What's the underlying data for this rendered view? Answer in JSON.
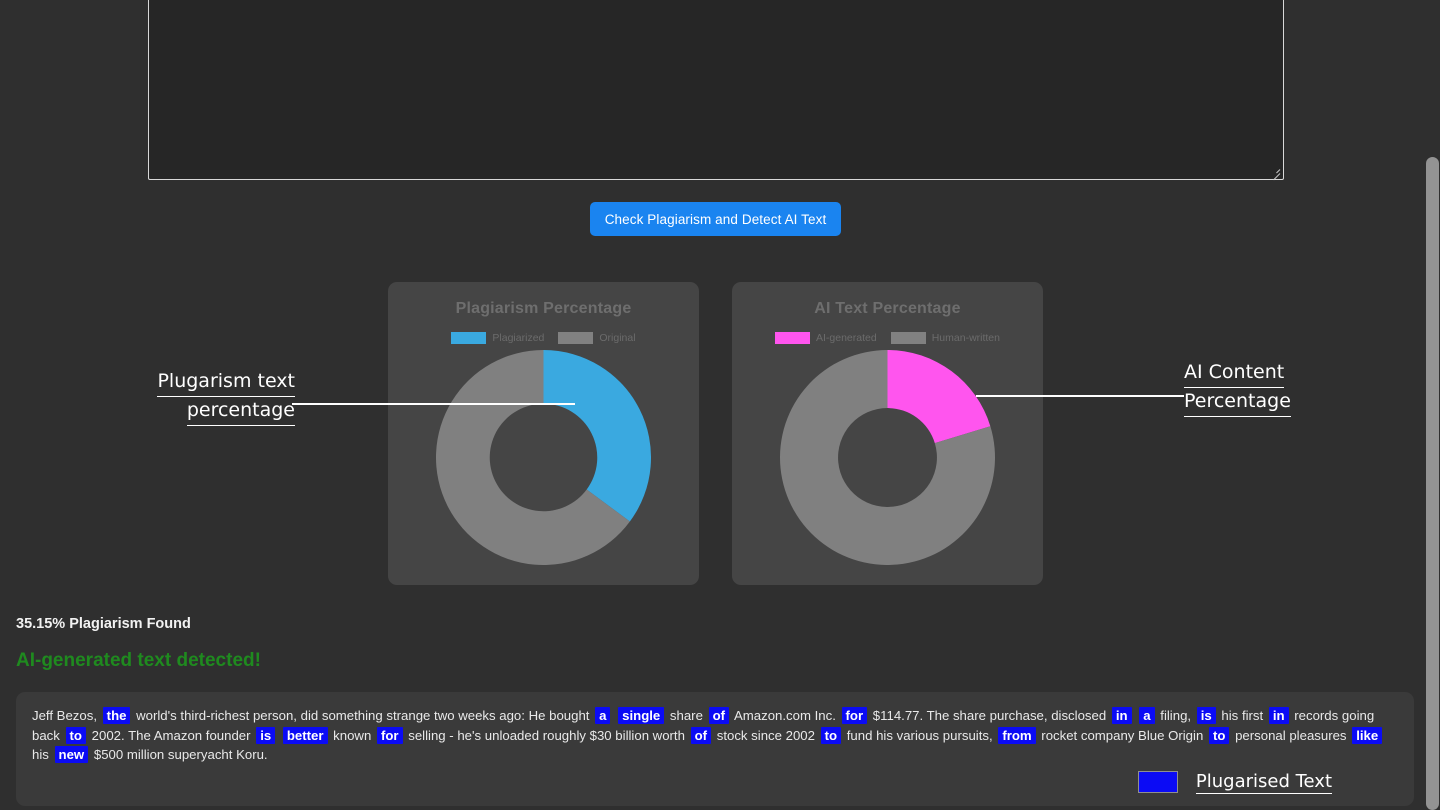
{
  "input": {
    "textarea_value": "",
    "textarea_placeholder": ""
  },
  "actions": {
    "check_button_label": "Check Plagiarism and Detect AI Text"
  },
  "charts": {
    "plagiarism": {
      "title": "Plagiarism Percentage",
      "legend": [
        {
          "label": "Plagiarized",
          "color": "#3aa9e0"
        },
        {
          "label": "Original",
          "color": "#818181"
        }
      ]
    },
    "ai": {
      "title": "AI Text Percentage",
      "legend": [
        {
          "label": "AI-generated",
          "color": "#ff55ee"
        },
        {
          "label": "Human-written",
          "color": "#818181"
        }
      ]
    }
  },
  "chart_data": [
    {
      "type": "pie",
      "title": "Plagiarism Percentage",
      "variant": "donut",
      "categories": [
        "Plagiarized",
        "Original"
      ],
      "values": [
        35.15,
        64.85
      ],
      "colors": [
        "#3aa9e0",
        "#808080"
      ],
      "units": "%",
      "start_angle_deg": 0,
      "direction": "clockwise",
      "inner_radius_ratio": 0.5,
      "legend_position": "top",
      "grid": false
    },
    {
      "type": "pie",
      "title": "AI Text Percentage",
      "variant": "donut",
      "categories": [
        "AI-generated",
        "Human-written"
      ],
      "values": [
        20.3,
        79.7
      ],
      "colors": [
        "#ff55ee",
        "#808080"
      ],
      "units": "%",
      "start_angle_deg": 0,
      "direction": "clockwise",
      "inner_radius_ratio": 0.46,
      "legend_position": "top",
      "grid": false
    }
  ],
  "annotations": {
    "left": {
      "line1": "Plugarism text",
      "line2": "percentage"
    },
    "right": {
      "line1": "AI Content",
      "line2": "Percentage"
    }
  },
  "results": {
    "plagiarism_found": "35.15% Plagiarism Found",
    "ai_detected": "AI-generated text detected!",
    "legend_swatch_color": "#0b0bf5",
    "legend_label": "Plugarised Text",
    "segments": [
      {
        "t": "Jeff Bezos,",
        "h": false
      },
      {
        "t": "the",
        "h": true
      },
      {
        "t": "world's third-richest person, did something strange two weeks ago: He bought",
        "h": false
      },
      {
        "t": "a",
        "h": true
      },
      {
        "t": "single",
        "h": true
      },
      {
        "t": "share",
        "h": false
      },
      {
        "t": "of",
        "h": true
      },
      {
        "t": "Amazon.com Inc.",
        "h": false
      },
      {
        "t": "for",
        "h": true
      },
      {
        "t": "$114.77. The share purchase, disclosed",
        "h": false
      },
      {
        "t": "in",
        "h": true
      },
      {
        "t": "a",
        "h": true
      },
      {
        "t": "filing,",
        "h": false
      },
      {
        "t": "is",
        "h": true
      },
      {
        "t": "his first",
        "h": false
      },
      {
        "t": "in",
        "h": true
      },
      {
        "t": "records going back",
        "h": false
      },
      {
        "t": "to",
        "h": true
      },
      {
        "t": "2002. The Amazon founder",
        "h": false
      },
      {
        "t": "is",
        "h": true
      },
      {
        "t": "better",
        "h": true
      },
      {
        "t": "known",
        "h": false
      },
      {
        "t": "for",
        "h": true
      },
      {
        "t": "selling - he's unloaded roughly $30 billion worth",
        "h": false
      },
      {
        "t": "of",
        "h": true
      },
      {
        "t": "stock since 2002",
        "h": false
      },
      {
        "t": "to",
        "h": true
      },
      {
        "t": "fund his various pursuits,",
        "h": false
      },
      {
        "t": "from",
        "h": true
      },
      {
        "t": "rocket company Blue Origin",
        "h": false
      },
      {
        "t": "to",
        "h": true
      },
      {
        "t": "personal pleasures",
        "h": false
      },
      {
        "t": "like",
        "h": true
      },
      {
        "t": "his",
        "h": false
      },
      {
        "t": "new",
        "h": true
      },
      {
        "t": "$500 million superyacht Koru.",
        "h": false
      }
    ]
  }
}
